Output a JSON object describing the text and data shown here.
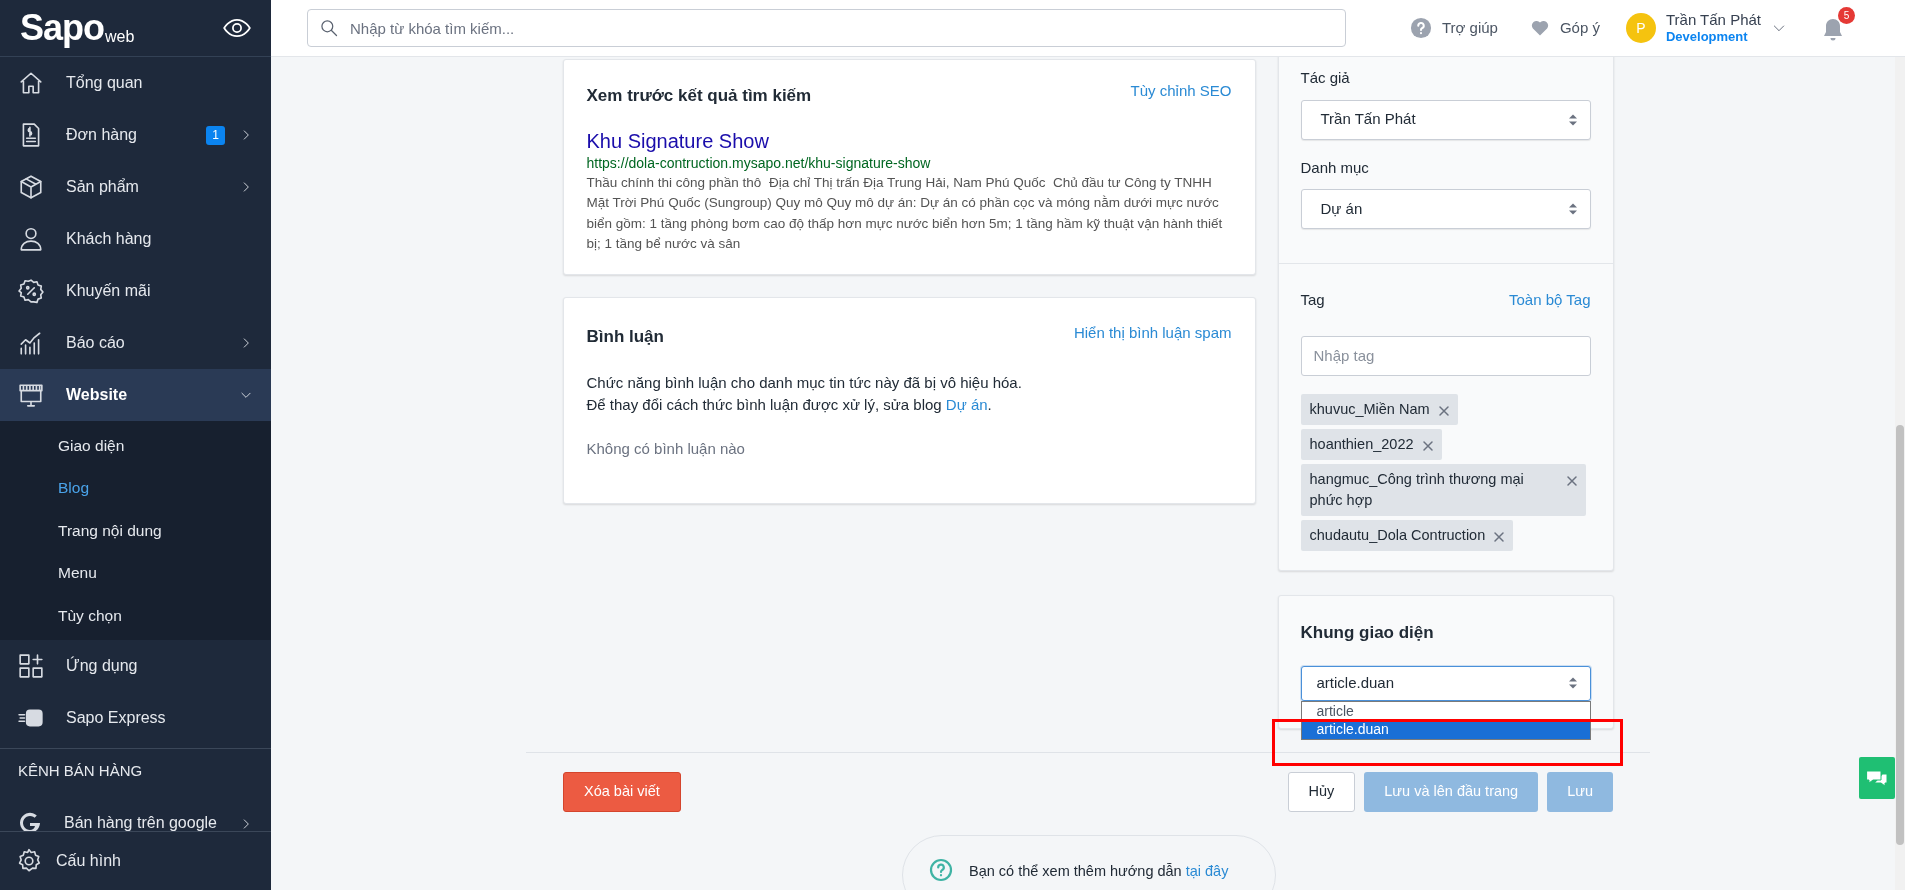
{
  "sidebar": {
    "logo": "Sapo",
    "logo_suffix": "web",
    "items": [
      {
        "label": "Tổng quan",
        "has_children": false,
        "selected": false
      },
      {
        "label": "Đơn hàng",
        "badge": "1",
        "has_children": true,
        "expanded": false,
        "selected": false
      },
      {
        "label": "Sản phẩm",
        "has_children": true,
        "expanded": false,
        "selected": false
      },
      {
        "label": "Khách hàng",
        "has_children": false,
        "selected": false
      },
      {
        "label": "Khuyến mãi",
        "has_children": false,
        "selected": false
      },
      {
        "label": "Báo cáo",
        "has_children": true,
        "expanded": false,
        "selected": false
      },
      {
        "label": "Website",
        "has_children": true,
        "expanded": true,
        "selected": true,
        "children": [
          {
            "label": "Giao diện",
            "selected": false
          },
          {
            "label": "Blog",
            "selected": true
          },
          {
            "label": "Trang nội dung",
            "selected": false
          },
          {
            "label": "Menu",
            "selected": false
          },
          {
            "label": "Tùy chọn",
            "selected": false
          }
        ]
      },
      {
        "label": "Ứng dụng",
        "has_children": false,
        "selected": false
      },
      {
        "label": "Sapo Express",
        "has_children": false,
        "selected": false
      }
    ],
    "section_title": "KÊNH BÁN HÀNG",
    "channels": [
      {
        "label": "Bán hàng trên google",
        "has_children": true,
        "expanded": false,
        "selected": false
      }
    ],
    "footer": {
      "label": "Cấu hình"
    }
  },
  "topbar": {
    "search": {
      "placeholder": "Nhập từ khóa tìm kiếm..."
    },
    "help": "Trợ giúp",
    "feedback": "Góp ý",
    "user": {
      "initial": "P",
      "name": "Trần Tấn Phát",
      "role": "Development"
    },
    "notifications": "5"
  },
  "seo_card": {
    "title": "Xem trước kết quả tìm kiếm",
    "action": "Tùy chỉnh SEO",
    "result_title": "Khu Signature Show",
    "result_url": "https://dola-contruction.mysapo.net/khu-signature-show",
    "result_description": "Thầu chính thi công phần thô  Địa chỉ Thị trấn Địa Trung Hải, Nam Phú Quốc  Chủ đầu tư Công ty TNHH Mặt Trời Phú Quốc (Sungroup) Quy mô Quy mô dự án: Dự án có phần cọc và móng nằm dưới mực nước biển gồm: 1 tầng phòng bơm cao độ thấp hơn mực nước biển hơn 5m; 1 tầng hầm kỹ thuật vận hành thiết bị; 1 tầng bể nước và sân"
  },
  "comments_card": {
    "title": "Bình luận",
    "action": "Hiển thị bình luận spam",
    "notice": "Chức năng bình luận cho danh mục tin tức này đã bị vô hiệu hóa.",
    "hint": "Để thay đổi cách thức bình luận được xử lý, sửa blog",
    "hint_link": "Dự án",
    "hint_end": ".",
    "empty": "Không có bình luận nào"
  },
  "side_panel": {
    "author": {
      "label": "Tác giả",
      "value": "Trần Tấn Phát"
    },
    "category": {
      "label": "Danh mục",
      "value": "Dự án"
    },
    "tags": {
      "label": "Tag",
      "action": "Toàn bộ Tag",
      "placeholder": "Nhập tag",
      "items": [
        {
          "label": "khuvuc_Miền Nam"
        },
        {
          "label": "hoanthien_2022"
        },
        {
          "label": "hangmuc_Công trình thương mại phức hợp"
        },
        {
          "label": "chudautu_Dola Contruction"
        }
      ]
    }
  },
  "layout_card": {
    "title": "Khung giao diện",
    "value": "article.duan",
    "expanded": true,
    "options": [
      {
        "label": "article",
        "selected": false
      },
      {
        "label": "article.duan",
        "selected": true
      }
    ]
  },
  "actions": {
    "delete": "Xóa bài viết",
    "cancel": "Hủy",
    "save_top": "Lưu và lên đầu trang",
    "save": "Lưu"
  },
  "help": {
    "text": "Bạn có thể xem thêm hướng dẫn",
    "link": "tại đây"
  }
}
